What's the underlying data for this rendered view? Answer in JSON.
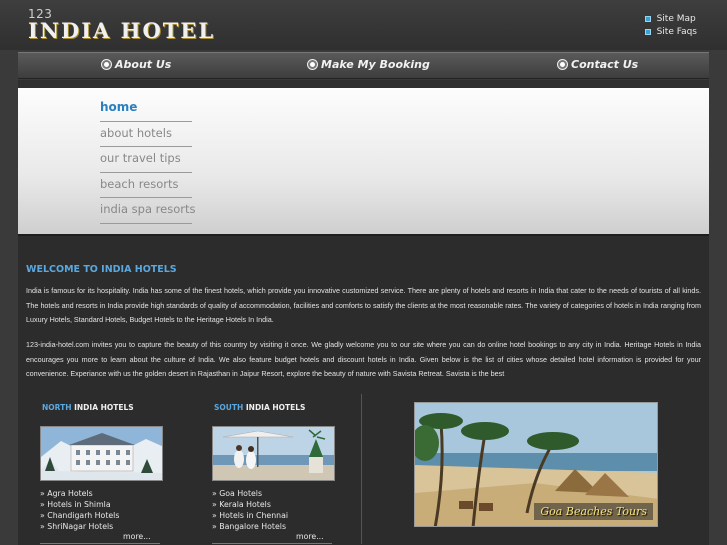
{
  "header": {
    "logo_number": "123",
    "logo_name": "India Hotel",
    "links": [
      "Site Map",
      "Site Faqs"
    ]
  },
  "nav": {
    "items": [
      "About Us",
      "Make My Booking",
      "Contact Us"
    ]
  },
  "submenu": {
    "items": [
      "home",
      "about hotels",
      "our travel tips",
      "beach resorts",
      "india spa resorts"
    ],
    "active": "home"
  },
  "main": {
    "heading": "WELCOME TO INDIA HOTELS",
    "paragraph1": "India is famous for its hospitality. India has some of the finest hotels, which provide you innovative customized service. There are plenty of hotels and resorts in India that cater to the needs of tourists of all kinds. The hotels and resorts in India provide high standards of quality of accommodation, facilities and comforts to satisfy the clients at the most reasonable rates. The variety of categories of hotels in India ranging from Luxury Hotels, Standard Hotels, Budget Hotels to the Heritage Hotels In India.",
    "paragraph2": "123-india-hotel.com invites you to capture the beauty of this country by visiting it once. We gladly welcome you to our site where you can do online hotel bookings to any city in India. Heritage Hotels in India encourages you more to learn about the culture of India. We also feature budget hotels and discount hotels in India. Given below is the list of cities whose detailed hotel information is provided for your convenience. Experiance with us the golden desert in Rajasthan in Jaipur Resort, explore the beauty of nature with Savista Retreat. Savista is the best"
  },
  "north": {
    "title_hl": "NORTH",
    "title_rest": "INDIA HOTELS",
    "items": [
      "» Agra Hotels",
      "» Hotels in Shimla",
      "» Chandigarh Hotels",
      "» ShriNagar Hotels"
    ],
    "more": "more..."
  },
  "south": {
    "title_hl": "SOUTH",
    "title_rest": "INDIA HOTELS",
    "items": [
      "» Goa Hotels",
      "» Kerala Hotels",
      "» Hotels in Chennai",
      "» Bangalore Hotels"
    ],
    "more": "more..."
  },
  "feature": {
    "caption": "Goa Beaches Tours"
  },
  "colors": {
    "accent_blue": "#5aa8e0",
    "active_link": "#2a7fc0",
    "background": "#2c2c2c"
  }
}
